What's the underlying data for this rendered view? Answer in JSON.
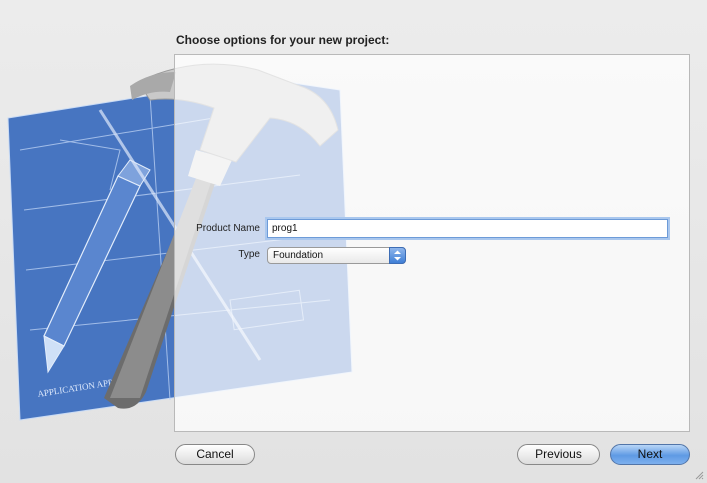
{
  "dialog": {
    "title": "Choose options for your new project:"
  },
  "form": {
    "product_name": {
      "label": "Product Name",
      "value": "prog1"
    },
    "type": {
      "label": "Type",
      "selected": "Foundation"
    }
  },
  "buttons": {
    "cancel": "Cancel",
    "previous": "Previous",
    "next": "Next"
  },
  "artwork": {
    "blueprint_text": "APPLICATION APP"
  },
  "colors": {
    "accent_button": "#6aa2e8",
    "focus_ring": "#a9c7ee",
    "blueprint": "#3b6fc0"
  }
}
